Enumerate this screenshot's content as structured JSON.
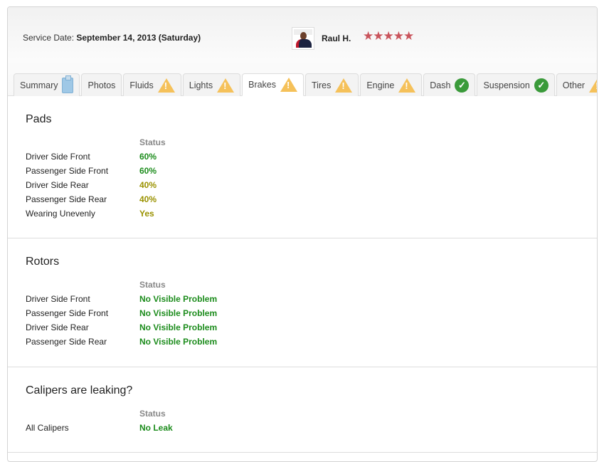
{
  "header": {
    "service_date_label": "Service Date:",
    "service_date": "September 14, 2013 (Saturday)",
    "technician": "Raul H.",
    "rating_stars": "★★★★★",
    "rating": 5
  },
  "tabs": [
    {
      "label": "Summary",
      "icon": "clipboard-icon"
    },
    {
      "label": "Photos",
      "icon": ""
    },
    {
      "label": "Fluids",
      "icon": "warning-icon"
    },
    {
      "label": "Lights",
      "icon": "warning-icon"
    },
    {
      "label": "Brakes",
      "icon": "warning-icon",
      "active": true
    },
    {
      "label": "Tires",
      "icon": "warning-icon"
    },
    {
      "label": "Engine",
      "icon": "warning-icon"
    },
    {
      "label": "Dash",
      "icon": "check-icon"
    },
    {
      "label": "Suspension",
      "icon": "check-icon"
    },
    {
      "label": "Other",
      "icon": "warning-icon"
    }
  ],
  "colors": {
    "good": "#1c8c1c",
    "warn": "#9a9200"
  },
  "sections": [
    {
      "title": "Pads",
      "status_header": "Status",
      "rows": [
        {
          "label": "Driver Side Front",
          "value": "60%",
          "level": "good"
        },
        {
          "label": "Passenger Side Front",
          "value": "60%",
          "level": "good"
        },
        {
          "label": "Driver Side Rear",
          "value": "40%",
          "level": "warn"
        },
        {
          "label": "Passenger Side Rear",
          "value": "40%",
          "level": "warn"
        },
        {
          "label": "Wearing Unevenly",
          "value": "Yes",
          "level": "warn"
        }
      ]
    },
    {
      "title": "Rotors",
      "status_header": "Status",
      "rows": [
        {
          "label": "Driver Side Front",
          "value": "No Visible Problem",
          "level": "good"
        },
        {
          "label": "Passenger Side Front",
          "value": "No Visible Problem",
          "level": "good"
        },
        {
          "label": "Driver Side Rear",
          "value": "No Visible Problem",
          "level": "good"
        },
        {
          "label": "Passenger Side Rear",
          "value": "No Visible Problem",
          "level": "good"
        }
      ]
    },
    {
      "title": "Calipers are leaking?",
      "status_header": "Status",
      "rows": [
        {
          "label": "All Calipers",
          "value": "No Leak",
          "level": "good"
        }
      ]
    }
  ]
}
